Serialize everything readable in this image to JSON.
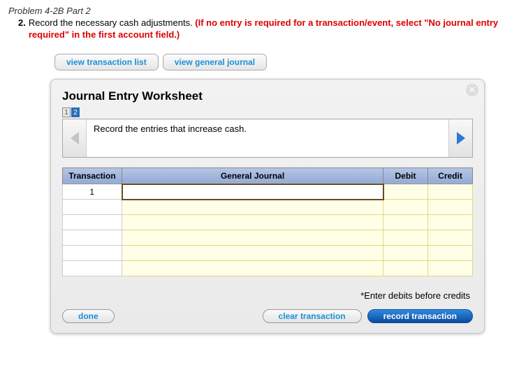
{
  "header": {
    "title": "Problem 4-2B Part 2",
    "item_number": "2.",
    "instruction_black": "Record the necessary cash adjustments. ",
    "instruction_red": "(If no entry is required for a transaction/event, select \"No journal entry required\" in the first account field.)"
  },
  "toolbar": {
    "view_transaction_list": "view transaction list",
    "view_general_journal": "view general journal"
  },
  "worksheet": {
    "title": "Journal Entry Worksheet",
    "pages": [
      "1",
      "2"
    ],
    "active_page_index": 1,
    "instruction": "Record the entries that increase cash.",
    "columns": {
      "transaction": "Transaction",
      "general_journal": "General Journal",
      "debit": "Debit",
      "credit": "Credit"
    },
    "rows": [
      {
        "transaction": "1",
        "general_journal": "",
        "debit": "",
        "credit": "",
        "active": true
      },
      {
        "transaction": "",
        "general_journal": "",
        "debit": "",
        "credit": ""
      },
      {
        "transaction": "",
        "general_journal": "",
        "debit": "",
        "credit": ""
      },
      {
        "transaction": "",
        "general_journal": "",
        "debit": "",
        "credit": ""
      },
      {
        "transaction": "",
        "general_journal": "",
        "debit": "",
        "credit": ""
      },
      {
        "transaction": "",
        "general_journal": "",
        "debit": "",
        "credit": ""
      }
    ],
    "tip": "*Enter debits before credits"
  },
  "footer": {
    "done": "done",
    "clear": "clear transaction",
    "record": "record transaction"
  }
}
